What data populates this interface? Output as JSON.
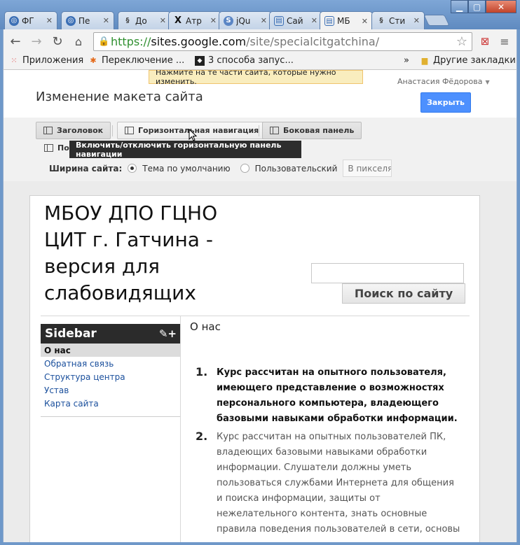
{
  "browser": {
    "tabs": [
      {
        "label": "ФГ",
        "icon": "chrome-icon",
        "active": false
      },
      {
        "label": "Пе",
        "icon": "chrome-icon",
        "active": false
      },
      {
        "label": "До",
        "icon": "swirl-icon",
        "active": false
      },
      {
        "label": "Атр",
        "icon": "x-icon",
        "active": false
      },
      {
        "label": "jQu",
        "icon": "s-icon",
        "active": false
      },
      {
        "label": "Сай",
        "icon": "sites-icon",
        "active": false
      },
      {
        "label": "МБ",
        "icon": "sites-icon",
        "active": true
      },
      {
        "label": "Сти",
        "icon": "swirl-icon",
        "active": false
      }
    ],
    "url": {
      "scheme": "https://",
      "host": "sites.google.com",
      "path": "/site/specialcitgatchina/"
    },
    "bookmarks": [
      {
        "label": "Приложения",
        "icon": "apps-grid-icon"
      },
      {
        "label": "Переключение ...",
        "icon": "joomla-icon"
      },
      {
        "label": "3 способа запус...",
        "icon": "diamond-icon"
      }
    ],
    "more_bookmarks": "»",
    "other_bookmarks": "Другие закладки"
  },
  "editor": {
    "notice": "Нажмите на те части сайта, которые нужно изменить.",
    "user": "Анастасия Фёдорова",
    "title": "Изменение макета сайта",
    "close_label": "Закрыть",
    "buttons": {
      "header": "Заголовок",
      "horizontal_nav": "Горизонтальная навигация",
      "sidebar": "Боковая панель",
      "footer": "По"
    },
    "tooltip": "Включить/отключить горизонтальную панель навигации",
    "width": {
      "label": "Ширина сайта:",
      "default_option": "Тема по умолчанию",
      "custom_option": "Пользовательский",
      "px_placeholder": "В пикселях"
    }
  },
  "site": {
    "title": "МБОУ ДПО ГЦНО ЦИТ г. Гатчина - версия для слабовидящих",
    "search_button": "Поиск по сайту",
    "sidebar": {
      "heading": "Sidebar",
      "tools": "✎+",
      "items": [
        "О нас",
        "Обратная связь",
        "Структура центра",
        "Устав",
        "Карта сайта"
      ]
    },
    "page_heading": "О нас",
    "list": [
      {
        "num": "1.",
        "text": "Курс рассчитан на опытного пользователя, имеющего представление о возможностях персонального компьютера, владеющего базовыми навыками обработки информации."
      },
      {
        "num": "2.",
        "text": "Курс рассчитан на опытных пользователей ПК, владеющих базовыми навыками обработки информации. Слушатели должны  уметь пользоваться службами Интернета для общения и поиска информации, защиты от нежелательного контента, знать основные правила поведения пользователей в сети, основы"
      }
    ]
  }
}
